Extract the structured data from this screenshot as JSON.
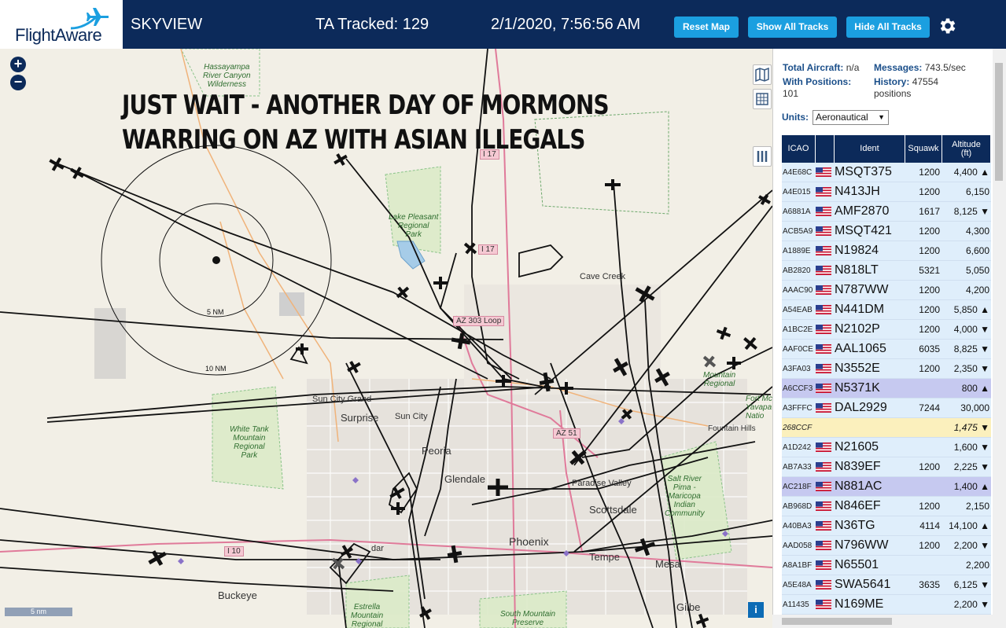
{
  "header": {
    "logo_text": "FlightAware",
    "title": "SKYVIEW",
    "tracked": "TA Tracked: 129",
    "datetime": "2/1/2020, 7:56:56 AM",
    "buttons": {
      "reset_map": "Reset Map",
      "show_all": "Show All Tracks",
      "hide_all": "Hide All Tracks"
    },
    "gear_icon": "gear-icon",
    "colors": {
      "header_bg": "#0c2a5a",
      "button_bg": "#1b9fe0"
    }
  },
  "map": {
    "zoom_in": "+",
    "zoom_out": "−",
    "overlay_line1": "JUST WAIT - ANOTHER DAY OF MORMONS",
    "overlay_line2": "WARRING ON AZ WITH ASIAN ILLEGALS",
    "ring_labels": [
      "5 NM",
      "10 NM"
    ],
    "scale_label": "5 nm",
    "info_button": "i",
    "places": {
      "cave_creek": "Cave Creek",
      "sun_city_grand": "Sun City Grand",
      "surprise": "Surprise",
      "sun_city": "Sun City",
      "peoria": "Peoria",
      "glendale": "Glendale",
      "paradise_valley": "Paradise Valley",
      "scottsdale": "Scottsdale",
      "phoenix": "Phoenix",
      "tempe": "Tempe",
      "mesa": "Mesa",
      "buckeye": "Buckeye",
      "gilbert": "Gilbe",
      "fountain_hills": "Fountain Hills",
      "avondale": "dar"
    },
    "parks": {
      "hassayampa": "Hassayampa\nRiver Canyon\nWilderness",
      "lake_pleasant": "Lake Pleasant\nRegional\nPark",
      "white_tank": "White Tank\nMountain\nRegional\nPark",
      "salt_river": "Salt River\nPima -\nMaricopa\nIndian\nCommunity",
      "estrella": "Estrella\nMountain\nRegional",
      "south_mountain": "South Mountain\nPreserve",
      "fort_mcdowell": "Fort McDo\nYavapa\nNatio",
      "mcdowell": "Mountain\nRegional"
    },
    "highways": {
      "i17_north": "I 17",
      "i17": "I 17",
      "az303": "AZ 303 Loop",
      "az51": "AZ 51",
      "i10": "I 10"
    }
  },
  "panel": {
    "total_aircraft_label": "Total Aircraft:",
    "total_aircraft_value": "n/a",
    "messages_label": "Messages:",
    "messages_value": "743.5/sec",
    "with_positions_label": "With Positions:",
    "with_positions_value": "101",
    "history_label": "History:",
    "history_value": "47554",
    "history_unit": "positions",
    "units_label": "Units:",
    "units_value": "Aeronautical",
    "columns": {
      "icao": "ICAO",
      "ident": "Ident",
      "squawk": "Squawk",
      "altitude": "Altitude\n(ft)"
    },
    "rows": [
      {
        "icao": "A4E68C",
        "flag": true,
        "ident": "MSQT375",
        "squawk": "1200",
        "alt": "4,400 ▲",
        "style": ""
      },
      {
        "icao": "A4E015",
        "flag": true,
        "ident": "N413JH",
        "squawk": "1200",
        "alt": "6,150",
        "style": ""
      },
      {
        "icao": "A6881A",
        "flag": true,
        "ident": "AMF2870",
        "squawk": "1617",
        "alt": "8,125 ▼",
        "style": ""
      },
      {
        "icao": "ACB5A9",
        "flag": true,
        "ident": "MSQT421",
        "squawk": "1200",
        "alt": "4,300",
        "style": ""
      },
      {
        "icao": "A1889E",
        "flag": true,
        "ident": "N19824",
        "squawk": "1200",
        "alt": "6,600",
        "style": ""
      },
      {
        "icao": "AB2820",
        "flag": true,
        "ident": "N818LT",
        "squawk": "5321",
        "alt": "5,050",
        "style": ""
      },
      {
        "icao": "AAAC90",
        "flag": true,
        "ident": "N787WW",
        "squawk": "1200",
        "alt": "4,200",
        "style": ""
      },
      {
        "icao": "A54EAB",
        "flag": true,
        "ident": "N441DM",
        "squawk": "1200",
        "alt": "5,850 ▲",
        "style": ""
      },
      {
        "icao": "A1BC2E",
        "flag": true,
        "ident": "N2102P",
        "squawk": "1200",
        "alt": "4,000 ▼",
        "style": ""
      },
      {
        "icao": "AAF0CE",
        "flag": true,
        "ident": "AAL1065",
        "squawk": "6035",
        "alt": "8,825 ▼",
        "style": ""
      },
      {
        "icao": "A3FA03",
        "flag": true,
        "ident": "N3552E",
        "squawk": "1200",
        "alt": "2,350 ▼",
        "style": ""
      },
      {
        "icao": "A6CCF3",
        "flag": true,
        "ident": "N5371K",
        "squawk": "",
        "alt": "800 ▲",
        "style": "sel"
      },
      {
        "icao": "A3FFFC",
        "flag": true,
        "ident": "DAL2929",
        "squawk": "7244",
        "alt": "30,000",
        "style": ""
      },
      {
        "icao": "268CCF",
        "flag": false,
        "ident": "",
        "squawk": "",
        "alt": "1,475 ▼",
        "style": "yel"
      },
      {
        "icao": "A1D242",
        "flag": true,
        "ident": "N21605",
        "squawk": "",
        "alt": "1,600 ▼",
        "style": ""
      },
      {
        "icao": "AB7A33",
        "flag": true,
        "ident": "N839EF",
        "squawk": "1200",
        "alt": "2,225 ▼",
        "style": ""
      },
      {
        "icao": "AC218F",
        "flag": true,
        "ident": "N881AC",
        "squawk": "",
        "alt": "1,400 ▲",
        "style": "sel"
      },
      {
        "icao": "AB968D",
        "flag": true,
        "ident": "N846EF",
        "squawk": "1200",
        "alt": "2,150",
        "style": ""
      },
      {
        "icao": "A40BA3",
        "flag": true,
        "ident": "N36TG",
        "squawk": "4114",
        "alt": "14,100 ▲",
        "style": ""
      },
      {
        "icao": "AAD058",
        "flag": true,
        "ident": "N796WW",
        "squawk": "1200",
        "alt": "2,200 ▼",
        "style": ""
      },
      {
        "icao": "A8A1BF",
        "flag": true,
        "ident": "N65501",
        "squawk": "",
        "alt": "2,200",
        "style": ""
      },
      {
        "icao": "A5E48A",
        "flag": true,
        "ident": "SWA5641",
        "squawk": "3635",
        "alt": "6,125 ▼",
        "style": ""
      },
      {
        "icao": "A11435",
        "flag": true,
        "ident": "N169ME",
        "squawk": "",
        "alt": "2,200 ▼",
        "style": ""
      }
    ]
  }
}
